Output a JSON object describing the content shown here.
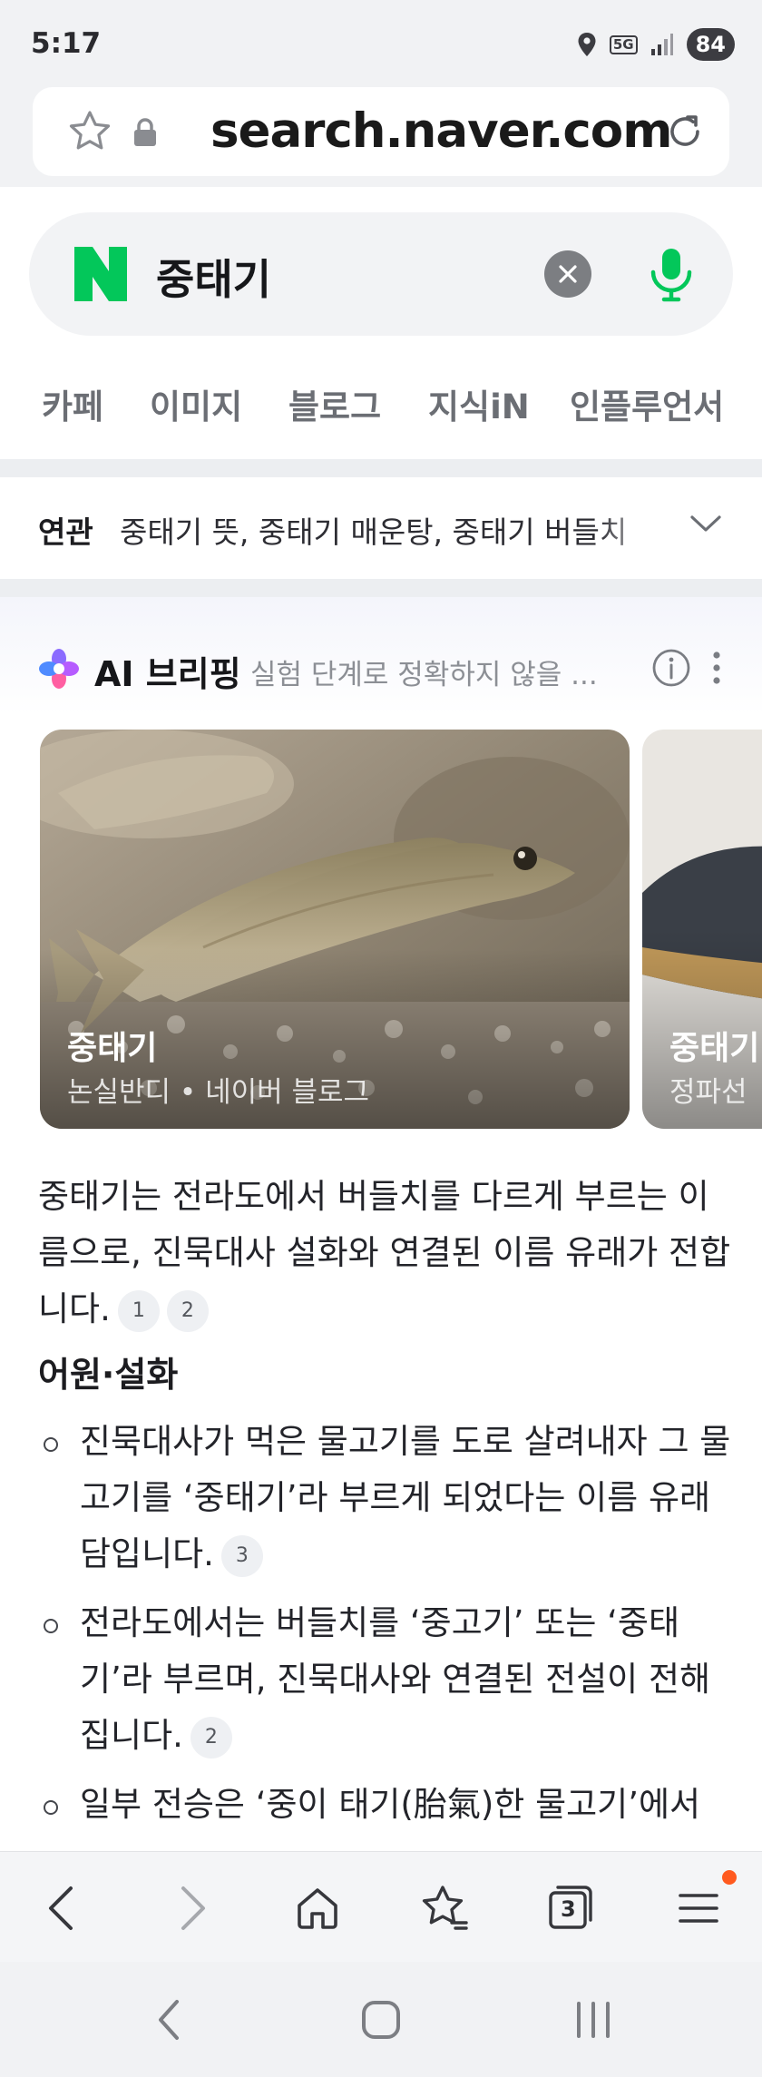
{
  "status_bar": {
    "time": "5:17",
    "network": "5G",
    "battery": "84"
  },
  "browser": {
    "url": "search.naver.com"
  },
  "search": {
    "query": "중태기"
  },
  "tabs": [
    "카페",
    "이미지",
    "블로그",
    "지식iN",
    "인플루언서"
  ],
  "related": {
    "label": "연관",
    "items": "중태기 뜻, 중태기 매운탕, 중태기 버들치"
  },
  "ai_briefing": {
    "title": "AI 브리핑",
    "subtitle": "실험 단계로 정확하지 않을 ...",
    "cards": [
      {
        "title": "중태기",
        "source": "논실반디 • 네이버 블로그"
      },
      {
        "title": "중태기",
        "source": "정파선"
      }
    ],
    "summary": "중태기는 전라도에서 버들치를 다르게 부르는 이름으로, 진묵대사 설화와 연결된 이름 유래가 전합니다.",
    "summary_citations": [
      "1",
      "2"
    ],
    "section_heading": "어원·설화",
    "bullets": [
      {
        "text": "진묵대사가 먹은 물고기를 도로 살려내자 그 물고기를 ‘중태기’라 부르게 되었다는 이름 유래담입니다.",
        "cite": "3"
      },
      {
        "text": "전라도에서는 버들치를 ‘중고기’ 또는 ‘중태기’라 부르며, 진묵대사와 연결된 전설이 전해집니다.",
        "cite": "2"
      },
      {
        "text": "일부 전승은 ‘중이 태기(胎氣)한 물고기’에서",
        "cite": ""
      }
    ]
  },
  "toolbar": {
    "tab_count": "3"
  },
  "colors": {
    "naver_green": "#03c75a",
    "notification_dot": "#ff5a1f"
  }
}
